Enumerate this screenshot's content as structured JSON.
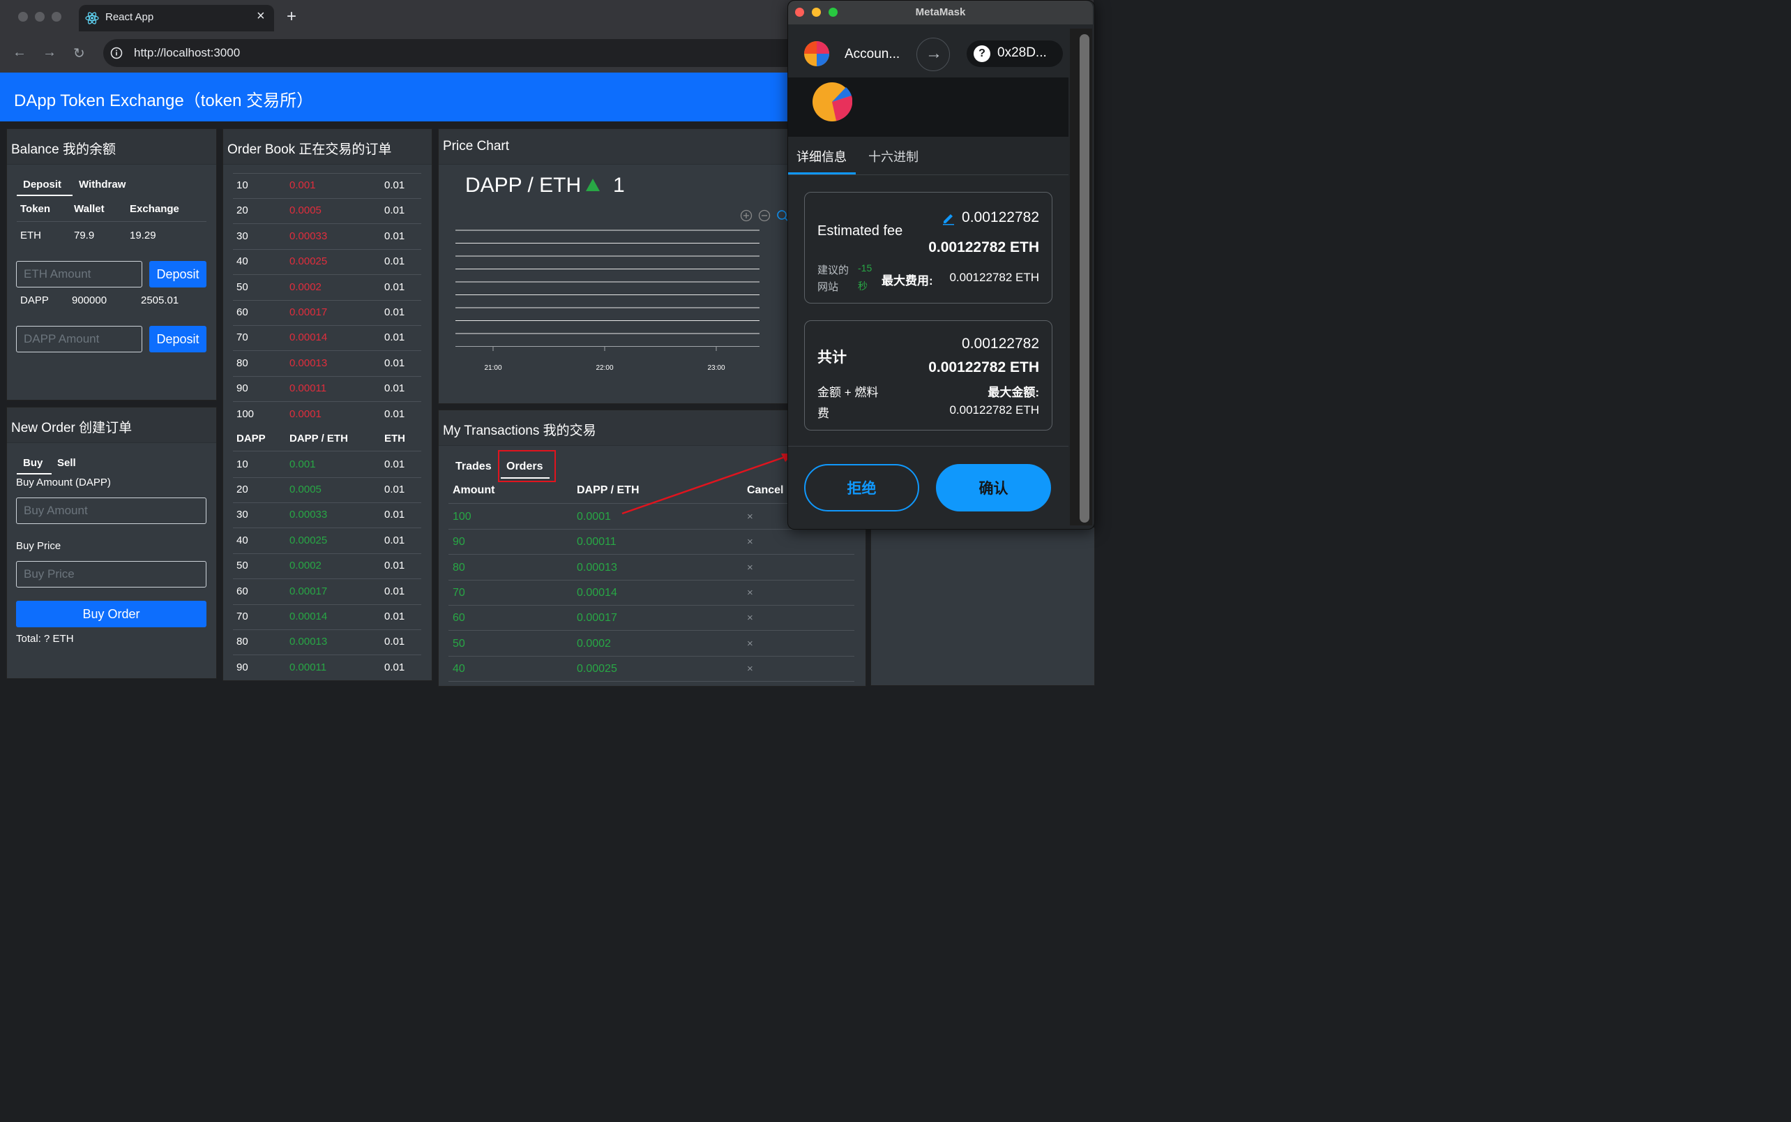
{
  "browser": {
    "tab_title": "React App",
    "url": "http://localhost:3000"
  },
  "app": {
    "title": "DApp Token Exchange（token 交易所）"
  },
  "balance": {
    "title": "Balance 我的余额",
    "tabs": [
      "Deposit",
      "Withdraw"
    ],
    "headers": [
      "Token",
      "Wallet",
      "Exchange"
    ],
    "rows": [
      {
        "token": "ETH",
        "wallet": "79.9",
        "exchange": "19.29"
      },
      {
        "token": "DAPP",
        "wallet": "900000",
        "exchange": "2505.01"
      }
    ],
    "eth_placeholder": "ETH Amount",
    "dapp_placeholder": "DAPP Amount",
    "deposit_label": "Deposit"
  },
  "new_order": {
    "title": "New Order 创建订单",
    "tabs": [
      "Buy",
      "Sell"
    ],
    "amount_label": "Buy Amount (DAPP)",
    "amount_placeholder": "Buy Amount",
    "price_label": "Buy Price",
    "price_placeholder": "Buy Price",
    "submit_label": "Buy Order",
    "total_label": "Total: ? ETH"
  },
  "order_book": {
    "title": "Order Book 正在交易的订单",
    "sell_orders": [
      [
        "10",
        "0.001",
        "0.01"
      ],
      [
        "20",
        "0.0005",
        "0.01"
      ],
      [
        "30",
        "0.00033",
        "0.01"
      ],
      [
        "40",
        "0.00025",
        "0.01"
      ],
      [
        "50",
        "0.0002",
        "0.01"
      ],
      [
        "60",
        "0.00017",
        "0.01"
      ],
      [
        "70",
        "0.00014",
        "0.01"
      ],
      [
        "80",
        "0.00013",
        "0.01"
      ],
      [
        "90",
        "0.00011",
        "0.01"
      ],
      [
        "100",
        "0.0001",
        "0.01"
      ]
    ],
    "headers": [
      "DAPP",
      "DAPP / ETH",
      "ETH"
    ],
    "buy_orders": [
      [
        "10",
        "0.001",
        "0.01"
      ],
      [
        "20",
        "0.0005",
        "0.01"
      ],
      [
        "30",
        "0.00033",
        "0.01"
      ],
      [
        "40",
        "0.00025",
        "0.01"
      ],
      [
        "50",
        "0.0002",
        "0.01"
      ],
      [
        "60",
        "0.00017",
        "0.01"
      ],
      [
        "70",
        "0.00014",
        "0.01"
      ],
      [
        "80",
        "0.00013",
        "0.01"
      ],
      [
        "90",
        "0.00011",
        "0.01"
      ]
    ]
  },
  "price_chart": {
    "title": "Price Chart",
    "pair": "DAPP / ETH",
    "price": "1",
    "trend_color": "#28a745",
    "x_ticks": [
      "21:00",
      "22:00",
      "23:00"
    ]
  },
  "transactions": {
    "title": "My Transactions 我的交易",
    "tabs": [
      "Trades",
      "Orders"
    ],
    "headers": [
      "Amount",
      "DAPP / ETH",
      "Cancel"
    ],
    "cancel_symbol": "×",
    "rows": [
      [
        "100",
        "0.0001"
      ],
      [
        "90",
        "0.00011"
      ],
      [
        "80",
        "0.00013"
      ],
      [
        "70",
        "0.00014"
      ],
      [
        "60",
        "0.00017"
      ],
      [
        "50",
        "0.0002"
      ],
      [
        "40",
        "0.00025"
      ]
    ]
  },
  "metamask": {
    "window_title": "MetaMask",
    "account_name": "Accoun...",
    "address": "0x28D...",
    "tabs": [
      "详细信息",
      "十六进制"
    ],
    "estimated_fee_label": "Estimated fee",
    "fee_value": "0.00122782",
    "fee_eth": "0.00122782 ETH",
    "site_label_1": "建议的",
    "site_label_2": "网站",
    "time_1": "-15",
    "time_2": "秒",
    "max_fee_label": "最大费用:",
    "max_fee_value": "0.00122782 ETH",
    "total_label": "共计",
    "total_value": "0.00122782",
    "total_eth": "0.00122782 ETH",
    "amount_gas_label_1": "金额 + 燃料",
    "amount_gas_label_2": "费",
    "max_amount_label": "最大金额:",
    "max_amount_value": "0.00122782 ETH",
    "reject_label": "拒绝",
    "confirm_label": "确认",
    "accent_color": "#1098fc"
  }
}
